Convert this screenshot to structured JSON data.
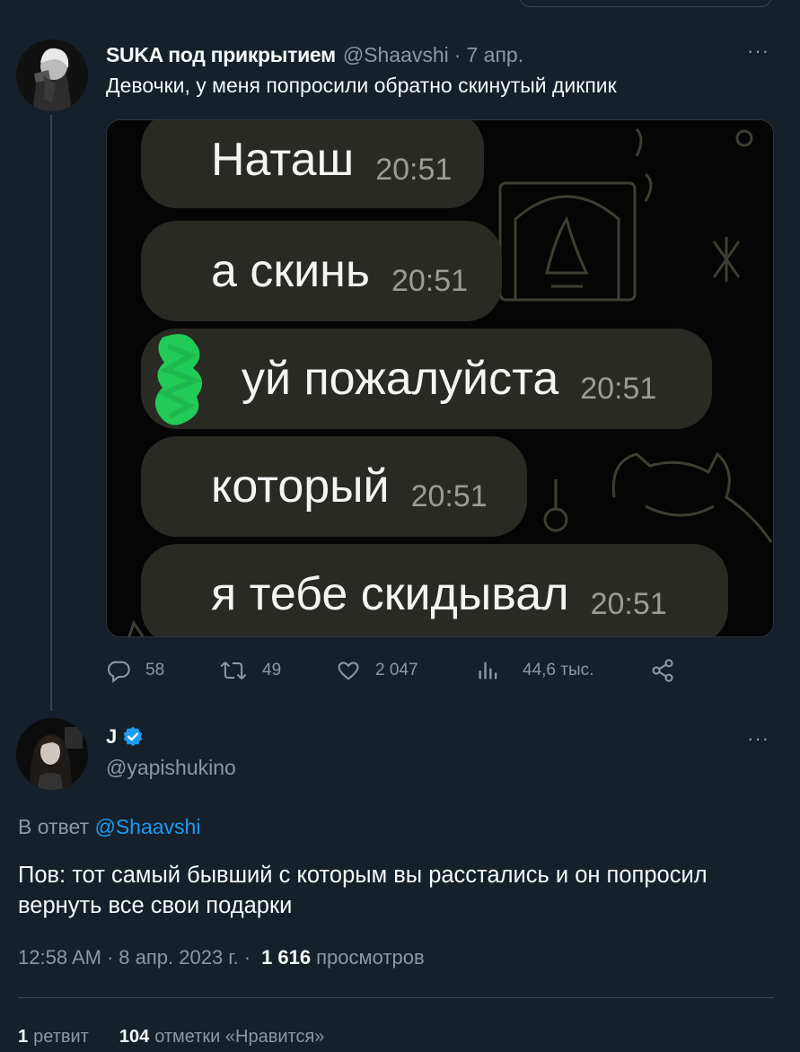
{
  "tweet1": {
    "name": "SUKA под прикрытием",
    "handle": "@Shaavshi",
    "sep": "·",
    "date": "7 апр.",
    "more": "···",
    "text": "Девочки, у меня попросили обратно скинутый дикпик",
    "media": {
      "messages": [
        {
          "text": "Наташ",
          "time": "20:51"
        },
        {
          "text": "а скинь",
          "time": "20:51"
        },
        {
          "text": "уй пожалуйста",
          "time": "20:51"
        },
        {
          "text": "который",
          "time": "20:51"
        },
        {
          "text": "я тебе скидывал",
          "time": "20:51"
        }
      ]
    },
    "actions": {
      "replies": "58",
      "retweets": "49",
      "likes": "2 047",
      "views": "44,6 тыс."
    }
  },
  "tweet2": {
    "name": "J",
    "handle": "@yapishukino",
    "more": "···",
    "reply_prefix": "В ответ",
    "reply_mention": "@Shaavshi",
    "text": "Пов: тот самый бывший с которым вы расстались и он попросил вернуть все свои подарки",
    "time": "12:58 AM",
    "sep": "·",
    "date": "8 апр. 2023 г.",
    "sep2": "·",
    "views_count": "1 616",
    "views_label": "просмотров",
    "retweet_count": "1",
    "retweet_label": "ретвит",
    "like_count": "104",
    "like_label": "отметки «Нравится»"
  },
  "colors": {
    "background": "#15202b",
    "text": "#f7f9f9",
    "muted": "#8b98a5",
    "mention": "#34a888",
    "verified": "#1d9bf0",
    "bubble": "#2a2a24",
    "scribble": "#22d35a"
  },
  "icons": {
    "reply": "reply-icon",
    "retweet": "retweet-icon",
    "like": "heart-icon",
    "views": "views-bar-icon",
    "share": "share-icon",
    "verified": "verified-badge-icon",
    "more": "more-dots-icon"
  }
}
